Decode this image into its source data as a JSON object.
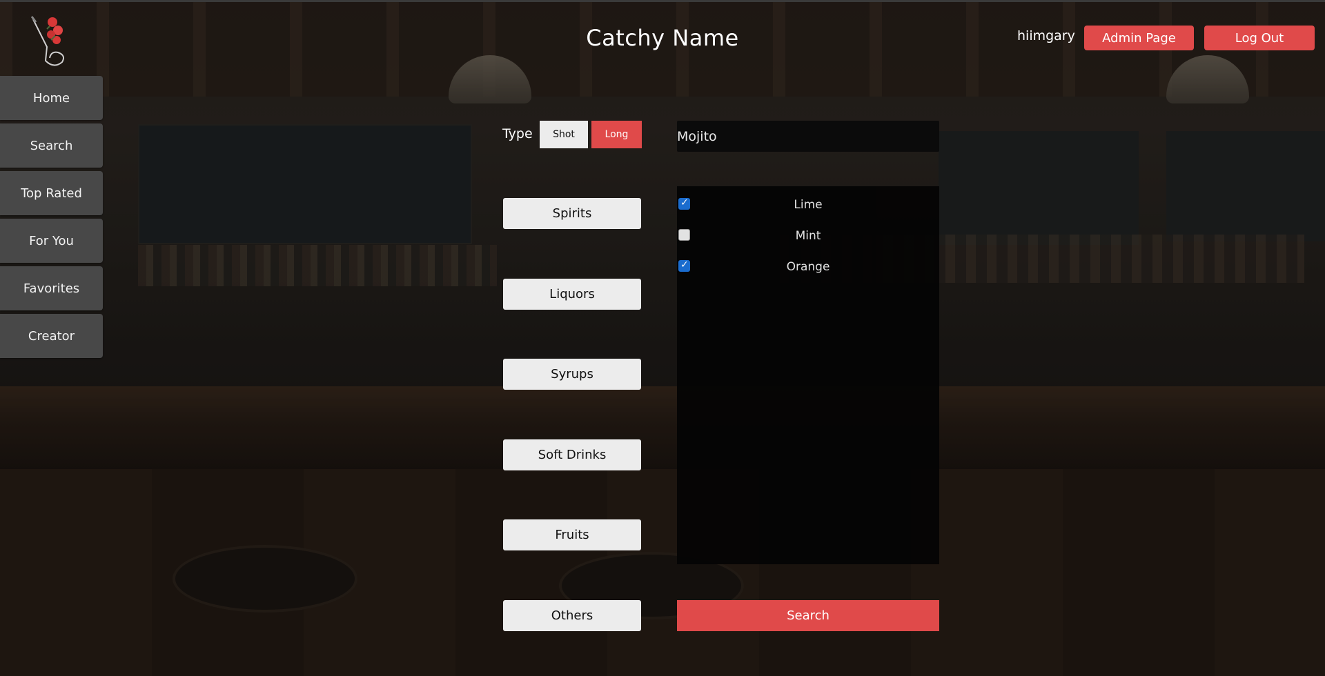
{
  "header": {
    "title": "Catchy Name",
    "username": "hiimgary",
    "admin_label": "Admin Page",
    "logout_label": "Log Out"
  },
  "sidebar": {
    "items": [
      {
        "label": "Home"
      },
      {
        "label": "Search"
      },
      {
        "label": "Top Rated"
      },
      {
        "label": "For You"
      },
      {
        "label": "Favorites"
      },
      {
        "label": "Creator"
      }
    ]
  },
  "type_selector": {
    "label": "Type",
    "options": [
      {
        "label": "Shot",
        "selected": false
      },
      {
        "label": "Long",
        "selected": true
      }
    ]
  },
  "categories": [
    {
      "label": "Spirits"
    },
    {
      "label": "Liquors"
    },
    {
      "label": "Syrups"
    },
    {
      "label": "Soft Drinks"
    },
    {
      "label": "Fruits"
    },
    {
      "label": "Others"
    }
  ],
  "search": {
    "name_value": "Mojito",
    "button_label": "Search"
  },
  "ingredients": [
    {
      "label": "Lime",
      "checked": true
    },
    {
      "label": "Mint",
      "checked": false
    },
    {
      "label": "Orange",
      "checked": true
    }
  ],
  "colors": {
    "accent": "#e04a4a",
    "nav_bg": "#484848",
    "panel_bg": "#050505",
    "light_button": "#ececec",
    "checkbox_checked": "#1a6fd4"
  },
  "icons": {
    "logo": "rose-logo-icon"
  }
}
